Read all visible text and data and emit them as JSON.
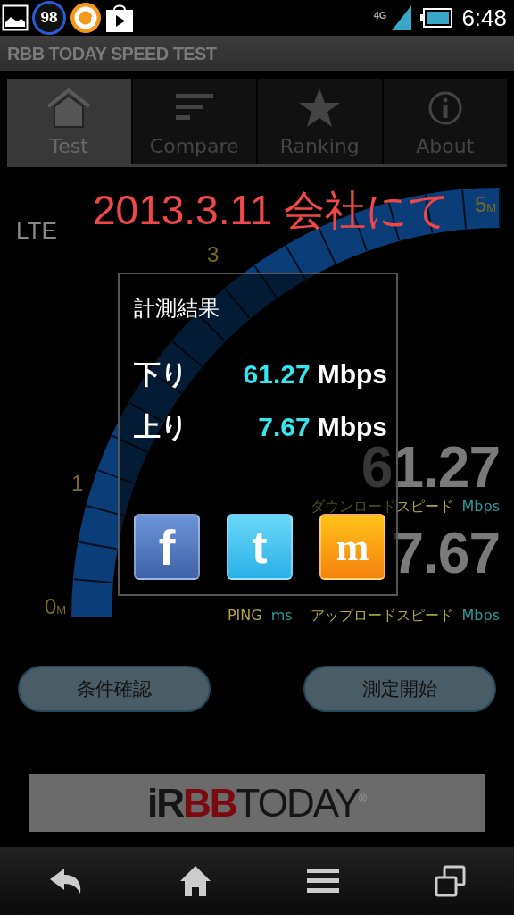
{
  "status_bar": {
    "badge": "98",
    "network": "4G",
    "time": "6:48"
  },
  "app_title": "RBB TODAY SPEED TEST",
  "tabs": [
    {
      "label": "Test",
      "selected": true
    },
    {
      "label": "Compare",
      "selected": false
    },
    {
      "label": "Ranking",
      "selected": false
    },
    {
      "label": "About",
      "selected": false
    }
  ],
  "annotation": "2013.3.11 会社にて",
  "gauge": {
    "network": "LTE",
    "scale": [
      {
        "value": "0",
        "unit": "M"
      },
      {
        "value": "1"
      },
      {
        "value": "3"
      },
      {
        "value": "5",
        "unit": "M"
      }
    ],
    "download": {
      "value": "61.27",
      "label": "ダウンロードスピード",
      "unit": "Mbps"
    },
    "ping": {
      "label": "PING",
      "unit": "ms"
    },
    "upload": {
      "value": "7.67",
      "label": "アップロードスピード",
      "unit": "Mbps"
    }
  },
  "result_dialog": {
    "title": "計測結果",
    "rows": [
      {
        "label": "下り",
        "value": "61.27",
        "unit": "Mbps"
      },
      {
        "label": "上り",
        "value": "7.67",
        "unit": "Mbps"
      }
    ],
    "share": [
      {
        "kind": "facebook",
        "glyph": "f"
      },
      {
        "kind": "twitter",
        "glyph": "t"
      },
      {
        "kind": "mixi",
        "glyph": "m"
      }
    ]
  },
  "buttons": [
    "条件確認",
    "測定開始"
  ],
  "banner": {
    "parts": [
      {
        "text": "iR",
        "kind": "dark"
      },
      {
        "text": "BB",
        "kind": "red"
      },
      {
        "text": "TODAY",
        "kind": "thin"
      }
    ],
    "mark": "®"
  }
}
